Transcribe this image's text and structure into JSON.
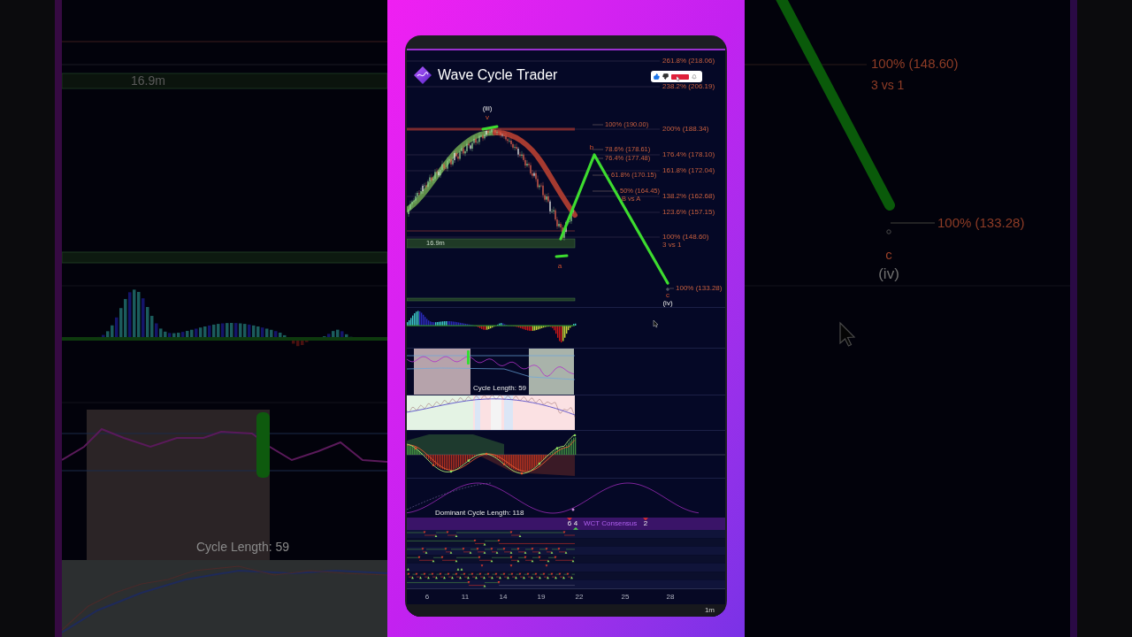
{
  "app": {
    "title": "Wave Cycle Trader",
    "reactions": {
      "liked": true
    }
  },
  "chart": {
    "fib_levels": [
      "261.8% (218.06)",
      "238.2% (206.19)",
      "200% (188.34)",
      "176.4% (178.10)",
      "161.8% (172.04)",
      "138.2% (162.68)",
      "123.6% (157.15)",
      "100% (148.60)"
    ],
    "fib_note": "3 vs 1",
    "retracements": [
      "100% (190.00)",
      "78.6% (178.61)",
      "76.4% (177.48)",
      "61.8% (170.15)",
      "50% (164.45)"
    ],
    "retracement_note": "B vs A",
    "target": "100% (133.28)",
    "zone_label": "16.9m",
    "wave_labels": [
      {
        "text": "(iii)",
        "kind": "degree"
      },
      {
        "text": "v",
        "kind": "minor"
      },
      {
        "text": "b",
        "kind": "minor"
      },
      {
        "text": "a",
        "kind": "minor"
      },
      {
        "text": "c",
        "kind": "minor"
      },
      {
        "text": "(iv)",
        "kind": "degree"
      }
    ]
  },
  "indicators": {
    "cycle_length": "Cycle Length: 59",
    "dominant_cycle": "Dominant Cycle Length: 118"
  },
  "consensus": {
    "label": "WCT Consensus",
    "badges": [
      {
        "text": "6",
        "kind": "bearish"
      },
      {
        "text": "4",
        "kind": "bullish"
      },
      {
        "text": "2",
        "kind": "bearish"
      }
    ]
  },
  "time_axis": [
    "6",
    "11",
    "14",
    "19",
    "22",
    "25",
    "28"
  ],
  "interval": "1m",
  "backdrop": {
    "left": [
      "16.9m",
      "Cycle Length: 59"
    ],
    "right": [
      "100% (148.60)",
      "3 vs 1",
      "100% (133.28)",
      "c",
      "(iv)"
    ]
  }
}
